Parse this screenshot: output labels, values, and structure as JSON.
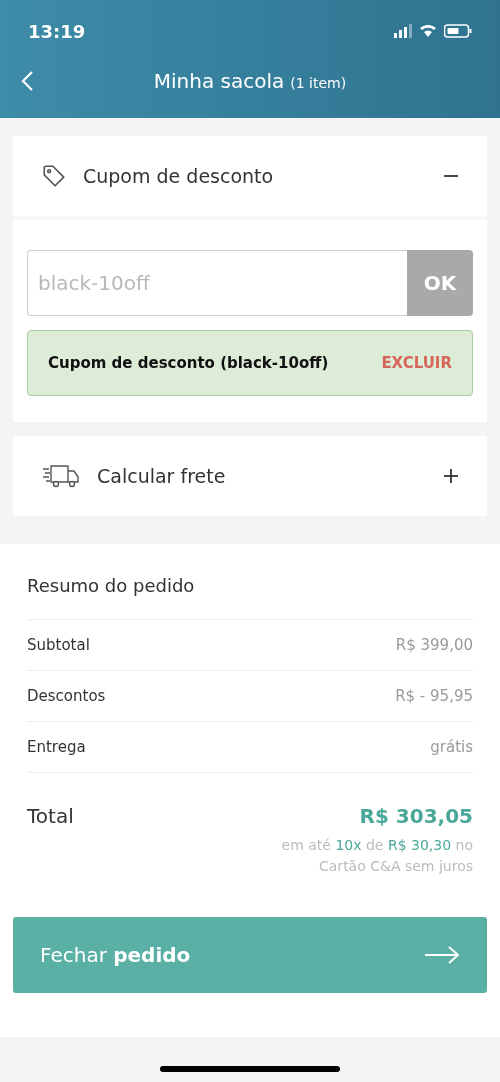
{
  "status_bar": {
    "time": "13:19"
  },
  "header": {
    "title": "Minha sacola",
    "count": "(1 item)"
  },
  "sections": [
    {
      "kind": "coupon",
      "title": "Cupom de desconto",
      "expanded": true,
      "coupon": {
        "placeholder": "black-10off",
        "apply": "OK",
        "applied": "Cupom de desconto (black-10off)",
        "remove": "EXCLUIR"
      }
    },
    {
      "kind": "shipping",
      "title": "Calcular frete",
      "expanded": false
    }
  ],
  "summary": {
    "title": "Resumo do pedido",
    "rows": [
      {
        "label": "Subtotal",
        "value": "R$ 399,00"
      },
      {
        "label": "Descontos",
        "value": "R$ - 95,95"
      },
      {
        "label": "Entrega",
        "value": "grátis"
      }
    ],
    "total_label": "Total",
    "total_value": "R$ 303,05",
    "installment_line1": "em até **10x** de **R$ 30,30** no",
    "installment_line2": "Cartão C&A sem juros"
  },
  "checkout_button": "Fechar **pedido**"
}
